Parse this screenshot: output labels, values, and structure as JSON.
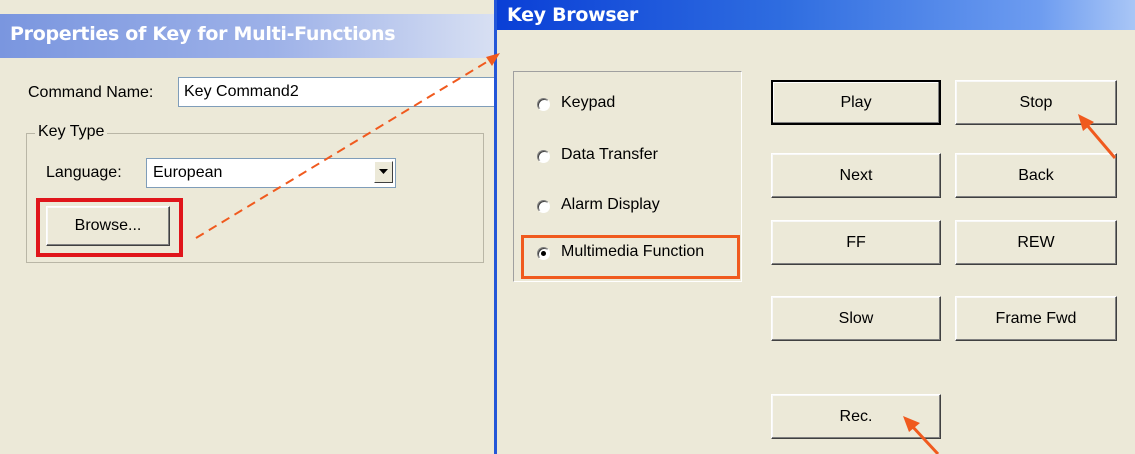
{
  "left_window": {
    "title": "Properties of Key for Multi-Functions",
    "command_name_label": "Command Name:",
    "command_name_value": "Key Command2",
    "key_type_label": "Key Type",
    "language_label": "Language:",
    "language_value": "European",
    "browse_button": "Browse..."
  },
  "right_window": {
    "title": "Key Browser",
    "radio_options": [
      {
        "label": "Keypad",
        "selected": false
      },
      {
        "label": "Data Transfer",
        "selected": false
      },
      {
        "label": "Alarm Display",
        "selected": false
      },
      {
        "label": "Multimedia Function",
        "selected": true
      }
    ],
    "buttons": {
      "play": "Play",
      "stop": "Stop",
      "next": "Next",
      "back": "Back",
      "ff": "FF",
      "rew": "REW",
      "slow": "Slow",
      "frame_fwd": "Frame Fwd",
      "rec": "Rec."
    }
  },
  "colors": {
    "highlight_red": "#e0151b",
    "highlight_orange": "#f05a1e",
    "arrow": "#f05a1e"
  },
  "icons": [
    "dropdown-arrow-icon",
    "callout-arrow-icon"
  ]
}
